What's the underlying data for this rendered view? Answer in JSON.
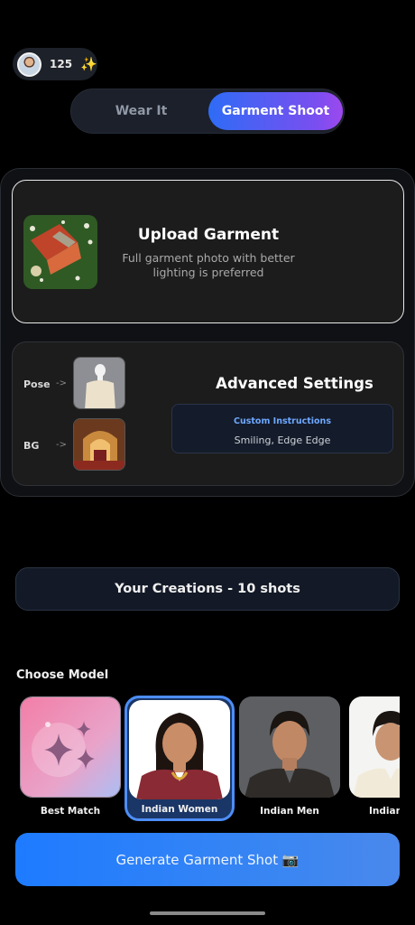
{
  "header": {
    "credits": "125",
    "avatar_icon": "user-avatar",
    "sparkle_icon": "✨"
  },
  "mode_toggle": {
    "options": [
      "Wear It",
      "Garment Shoot"
    ],
    "selected": "Garment Shoot"
  },
  "upload": {
    "title": "Upload Garment",
    "subtitle": "Full garment photo with better lighting is preferred"
  },
  "advanced": {
    "title": "Advanced Settings",
    "pose_label": "Pose",
    "bg_label": "BG",
    "arrow": "->",
    "instructions_label": "Custom Instructions",
    "instructions_value": "Smiling, Edge Edge"
  },
  "creations": {
    "label": "Your Creations - 10 shots"
  },
  "models": {
    "heading": "Choose Model",
    "items": [
      {
        "name": "Best Match",
        "selected": false
      },
      {
        "name": "Indian Women",
        "selected": true
      },
      {
        "name": "Indian Men",
        "selected": false
      },
      {
        "name": "Indian",
        "selected": false
      }
    ]
  },
  "cta": {
    "label": "Generate Garment Shot 📷"
  },
  "colors": {
    "accent_blue": "#1e7bff",
    "accent_purple": "#9d49ee",
    "selected_border": "#4d8ef7"
  }
}
